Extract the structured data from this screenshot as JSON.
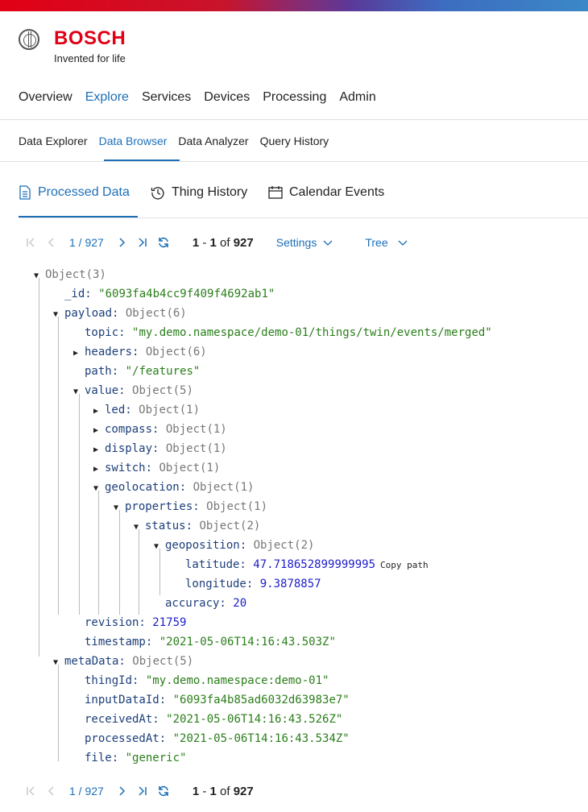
{
  "brand": {
    "name": "BOSCH",
    "tagline": "Invented for life"
  },
  "nav_main": [
    "Overview",
    "Explore",
    "Services",
    "Devices",
    "Processing",
    "Admin"
  ],
  "nav_main_active": "Explore",
  "nav_sub": [
    "Data Explorer",
    "Data Browser",
    "Data Analyzer",
    "Query History"
  ],
  "nav_sub_active": "Data Browser",
  "tabs": [
    {
      "label": "Processed Data",
      "icon": "document-icon"
    },
    {
      "label": "Thing History",
      "icon": "history-icon"
    },
    {
      "label": "Calendar Events",
      "icon": "calendar-icon"
    }
  ],
  "pager": {
    "page_text": "1 / 927",
    "range_start": "1",
    "range_sep": " - ",
    "range_end": "1",
    "of": " of ",
    "total": "927",
    "settings": "Settings",
    "view": "Tree"
  },
  "tree": {
    "root": "Object",
    "root_count": "(3)",
    "id_key": "_id:",
    "id_val": "\"6093fa4b4cc9f409f4692ab1\"",
    "payload_key": "payload:",
    "payload_type": "Object(6)",
    "topic_key": "topic:",
    "topic_val": "\"my.demo.namespace/demo-01/things/twin/events/merged\"",
    "headers_key": "headers:",
    "headers_type": "Object(6)",
    "path_key": "path:",
    "path_val": "\"/features\"",
    "value_key": "value:",
    "value_type": "Object(5)",
    "led_key": "led:",
    "led_type": "Object(1)",
    "compass_key": "compass:",
    "compass_type": "Object(1)",
    "display_key": "display:",
    "display_type": "Object(1)",
    "switch_key": "switch:",
    "switch_type": "Object(1)",
    "geolocation_key": "geolocation:",
    "geolocation_type": "Object(1)",
    "properties_key": "properties:",
    "properties_type": "Object(1)",
    "status_key": "status:",
    "status_type": "Object(2)",
    "geoposition_key": "geoposition:",
    "geoposition_type": "Object(2)",
    "latitude_key": "latitude:",
    "latitude_val": "47.718652899999995",
    "copy_path": "Copy path",
    "longitude_key": "longitude:",
    "longitude_val": "9.3878857",
    "accuracy_key": "accuracy:",
    "accuracy_val": "20",
    "revision_key": "revision:",
    "revision_val": "21759",
    "timestamp_key": "timestamp:",
    "timestamp_val": "\"2021-05-06T14:16:43.503Z\"",
    "metadata_key": "metaData:",
    "metadata_type": "Object(5)",
    "thingid_key": "thingId:",
    "thingid_val": "\"my.demo.namespace:demo-01\"",
    "inputdataid_key": "inputDataId:",
    "inputdataid_val": "\"6093fa4b85ad6032d63983e7\"",
    "receivedat_key": "receivedAt:",
    "receivedat_val": "\"2021-05-06T14:16:43.526Z\"",
    "processedat_key": "processedAt:",
    "processedat_val": "\"2021-05-06T14:16:43.534Z\"",
    "file_key": "file:",
    "file_val": "\"generic\""
  }
}
